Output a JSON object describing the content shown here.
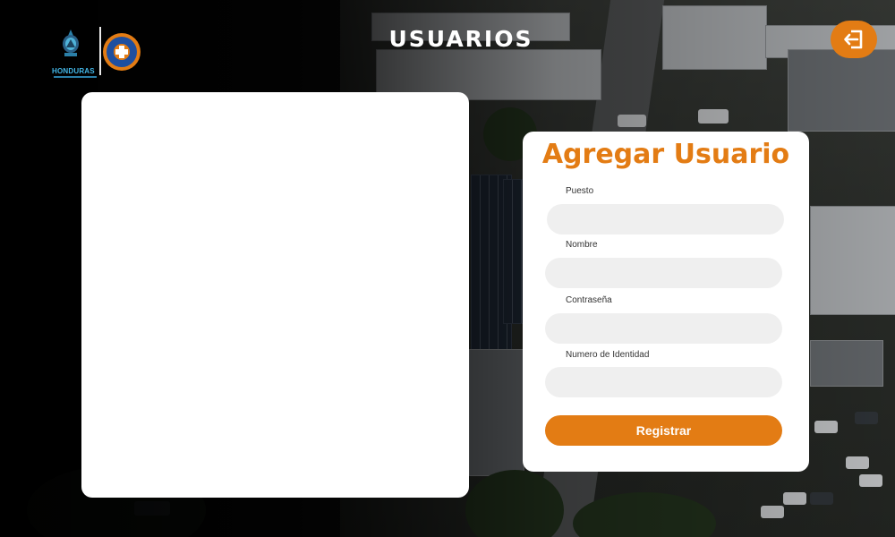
{
  "header": {
    "brand_word": "HONDURAS",
    "page_title": "USUARIOS",
    "logout_icon": "logout-arrow-icon"
  },
  "user_list_panel": {},
  "add_user_form": {
    "title": "Agregar Usuario",
    "fields": [
      {
        "label": "Puesto",
        "value": "",
        "placeholder": ""
      },
      {
        "label": "Nombre",
        "value": "",
        "placeholder": ""
      },
      {
        "label": "Contraseña",
        "value": "",
        "placeholder": ""
      },
      {
        "label": "Numero de Identidad",
        "value": "",
        "placeholder": ""
      }
    ],
    "submit_label": "Registrar"
  },
  "colors": {
    "accent": "#e37c14",
    "panel": "#ffffff",
    "input_bg": "#efefef",
    "brand_blue": "#43b6e6",
    "copeco_blue": "#1e4fa0"
  }
}
